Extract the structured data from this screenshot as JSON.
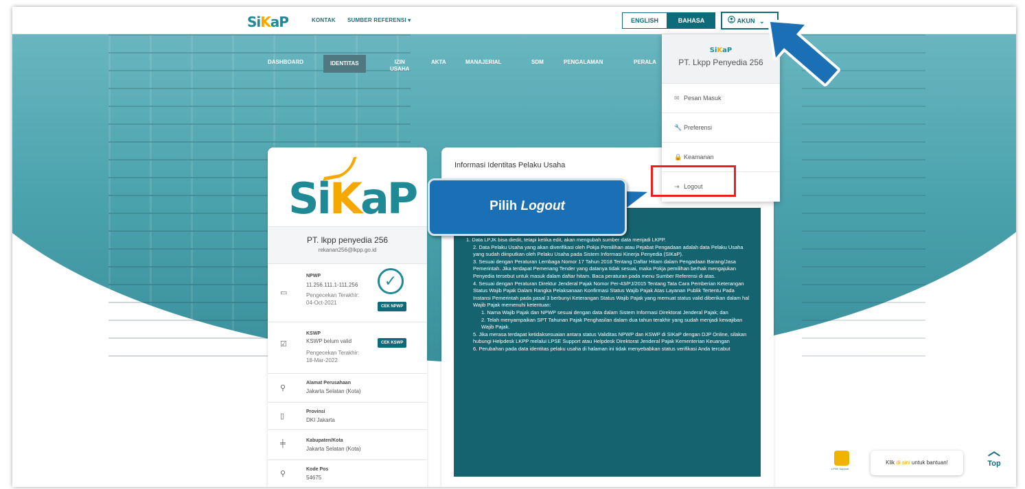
{
  "header": {
    "logo_left": "Si",
    "logo_k": "K",
    "logo_right": "aP",
    "nav": [
      "KONTAK",
      "SUMBER REFERENSI ▾"
    ],
    "lang_en": "ENGLISH",
    "lang_id": "BAHASA",
    "akun_label": "AKUN"
  },
  "main_nav": [
    "DASHBOARD",
    "IDENTITAS",
    "IZIN",
    "USAHA",
    "AKTA",
    "MANAJERIAL",
    "SDM",
    "PENGALAMAN",
    "PERALA"
  ],
  "profile": {
    "company": "PT. lkpp penyedia 256",
    "email": "rekanan256@lkpp.go.id",
    "npwp_label": "NPWP",
    "npwp_value": "11.256.111.1-111.256",
    "npwp_check_label": "Pengecekan Terakhir:",
    "npwp_check_date": "04-Oct-2021",
    "cek_npwp": "CEK NPWP",
    "kswp_label": "KSWP",
    "kswp_value": "KSWP belum valid",
    "kswp_check_label": "Pengecekan Terakhir:",
    "kswp_check_date": "18-Mar-2022",
    "cek_kswp": "CEK KSWP",
    "alamat_label": "Alamat Perusahaan",
    "alamat_value": "Jakarta Selatan (Kota)",
    "provinsi_label": "Provinsi",
    "provinsi_value": "DKI Jakarta",
    "kab_label": "Kabupaten/Kota",
    "kab_value": "Jakarta Selatan (Kota)",
    "kodepos_label": "Kode Pos",
    "kodepos_value": "54675"
  },
  "info": {
    "title": "Informasi Identitas Pelaku Usaha",
    "items": [
      "1. Data LPJK bisa diedit, tetapi ketika edit, akan mengubah sumber data menjadi LKPP.",
      "2. Data Pelaku Usaha yang akan diverifikasi oleh Pokja Pemilihan atau Pejabat Pengadaan adalah data Pelaku Usaha yang sudah diinputkan oleh Pelaku Usaha pada Sistem Informasi Kinerja Penyedia (SIKaP).",
      "3. Sesuai dengan Peraturan Lembaga Nomor 17 Tahun 2018 Tentang Daftar Hitam dalam Pengadaan Barang/Jasa Pemerintah. Jika terdapat Pemenang Tender yang datanya tidak sesuai, maka Pokja pemilihan berhak mengajukan Penyedia tersebut untuk masuk dalam daftar hitam. Baca peraturan pada menu Sumber Referensi di atas.",
      "4. Sesuai dengan Peraturan Direktur Jenderal Pajak Nomor Per-43/PJ/2015 Tentang Tata Cara Pemberian Keterangan Status Wajib Pajak Dalam Rangka Pelaksanaan Konfirmasi Status Wajib Pajak Atas Layanan Publik Tertentu Pada Instansi Pemerintah pada pasal 3 berbunyi Keterangan Status Wajib Pajak yang memuat status valid diberikan dalam hal Wajib Pajak memenuhi ketentuan:",
      "1. Nama Wajib Pajak dan NPWP sesuai dengan data dalam Sistem Informasi Direktorat Jenderal Pajak; dan",
      "2. Telah menyampaikan SPT Tahunan Pajak Penghasilan dalam dua tahun terakhir yang sudah menjadi kewajiban Wajib Pajak.",
      "5. Jika merasa terdapat ketidaksesuaian antara status Validitas NPWP dan KSWP di SIKaP dengan DJP Online, silakan hubungi Helpdesk LKPP melalui LPSE Support atau Helpdesk Direktorat Jenderal Pajak Kementerian Keuangan",
      "6. Perubahan pada data identitas pelaku usaha di halaman ini tidak menyebabkan status verifikasi Anda tercabut"
    ]
  },
  "dropdown": {
    "logo": "SiKaP",
    "company": "PT. Lkpp Penyedia 256",
    "items": [
      "Pesan Masuk",
      "Preferensi",
      "Keamanan",
      "Logout"
    ]
  },
  "callout": {
    "prefix": "Pilih ",
    "emph": "Logout"
  },
  "help": {
    "icon_label": "LPSE Support",
    "pre": "Klik ",
    "link": "di sini",
    "post": " untuk bantuan!",
    "top": "Top"
  },
  "colors": {
    "primary": "#0e6b7a",
    "accent": "#f6a800",
    "callout": "#1a6fb5",
    "highlight": "#ee1c1c"
  }
}
